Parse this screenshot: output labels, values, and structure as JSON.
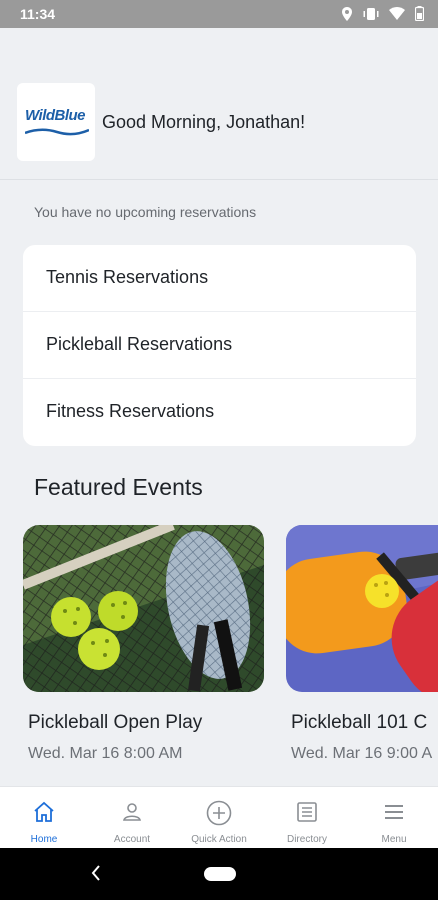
{
  "status_bar": {
    "time": "11:34"
  },
  "header": {
    "logo_text": "WildBlue",
    "greeting": "Good Morning, Jonathan!"
  },
  "reservations": {
    "empty_message": "You have no upcoming reservations",
    "items": [
      {
        "label": "Tennis Reservations"
      },
      {
        "label": "Pickleball Reservations"
      },
      {
        "label": "Fitness Reservations"
      }
    ]
  },
  "featured": {
    "title": "Featured Events",
    "events": [
      {
        "name": "Pickleball Open Play",
        "date": "Wed. Mar 16 8:00 AM"
      },
      {
        "name": "Pickleball 101 C",
        "date": "Wed. Mar 16 9:00 A"
      }
    ]
  },
  "bottom_nav": {
    "items": [
      {
        "label": "Home",
        "icon": "home-icon",
        "active": true
      },
      {
        "label": "Account",
        "icon": "account-icon",
        "active": false
      },
      {
        "label": "Quick Action",
        "icon": "plus-circle-icon",
        "active": false
      },
      {
        "label": "Directory",
        "icon": "directory-icon",
        "active": false
      },
      {
        "label": "Menu",
        "icon": "menu-icon",
        "active": false
      }
    ]
  },
  "colors": {
    "accent": "#1e6fd9",
    "logo_blue": "#1d5fa8",
    "background": "#eef0f3"
  }
}
